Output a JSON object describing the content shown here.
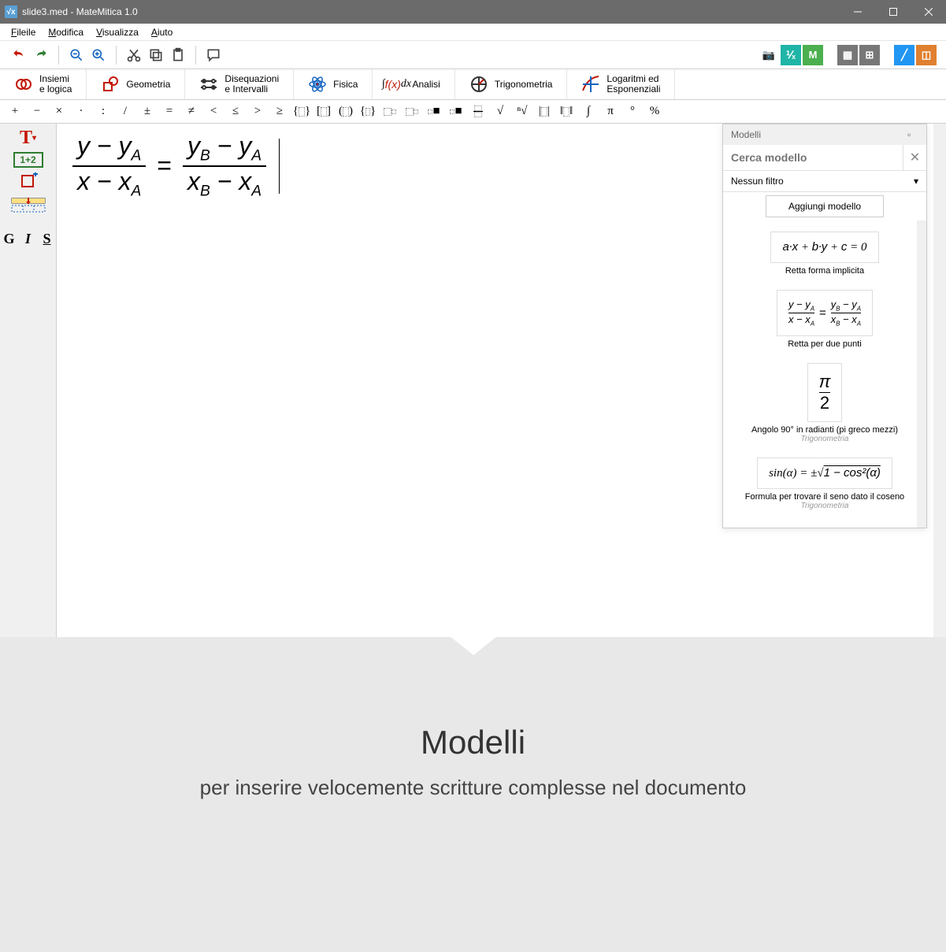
{
  "window": {
    "title": "slide3.med - MateMitica 1.0",
    "app_icon_text": "√x"
  },
  "menu": {
    "file": "File",
    "modifica": "Modifica",
    "visualizza": "Visualizza",
    "aiuto": "Aiuto"
  },
  "ribbon": {
    "insiemi": "Insiemi\ne logica",
    "geometria": "Geometria",
    "disequazioni": "Disequazioni\ne Intervalli",
    "fisica": "Fisica",
    "analisi": "Analisi",
    "trigonometria": "Trigonometria",
    "logaritmi": "Logaritmi ed\nEsponenziali"
  },
  "symbols": {
    "plus": "+",
    "minus": "−",
    "times": "×",
    "dot": "·",
    "colon": ":",
    "slash": "/",
    "pm": "±",
    "eq": "=",
    "neq": "≠",
    "lt": "<",
    "le": "≤",
    "gt": ">",
    "ge": "≥",
    "braces": "{}",
    "brackets": "[]",
    "parens": "()",
    "set": "{}",
    "box1": "□",
    "box2": "▫",
    "frac": "▭",
    "sqrt": "√",
    "nroot": "ⁿ√",
    "abs": "|·|",
    "norm": "‖·‖",
    "int": "∫",
    "pi": "π",
    "deg": "°",
    "pct": "%"
  },
  "sidebar": {
    "text": "T",
    "formula_box": "1+2",
    "bold": "G",
    "italic": "I",
    "underline": "S"
  },
  "equation": {
    "num1_a": "y",
    "num1_b": "y",
    "sub1": "A",
    "den1_a": "x",
    "den1_b": "x",
    "eq": "=",
    "num2_a": "y",
    "sub2a": "B",
    "num2_b": "y",
    "sub2b": "A",
    "den2_a": "x",
    "den2_b": "x"
  },
  "panel": {
    "title": "Modelli",
    "search_placeholder": "Cerca modello",
    "filter": "Nessun filtro",
    "add": "Aggiungi modello",
    "models": [
      {
        "formula_html": "a·x + b·y + c = 0",
        "caption": "Retta forma implicita",
        "sub": ""
      },
      {
        "formula_html": "fraction-two-points",
        "caption": "Retta per due punti",
        "sub": ""
      },
      {
        "formula_html": "pi-over-2",
        "caption": "Angolo 90° in radianti (pi greco mezzi)",
        "sub": "Trigonometria"
      },
      {
        "formula_html": "sin(α) = ±√(1 − cos²(α))",
        "caption": "Formula per trovare il seno dato il coseno",
        "sub": "Trigonometria"
      }
    ]
  },
  "promo": {
    "title": "Modelli",
    "subtitle": "per inserire velocemente scritture complesse nel documento"
  }
}
